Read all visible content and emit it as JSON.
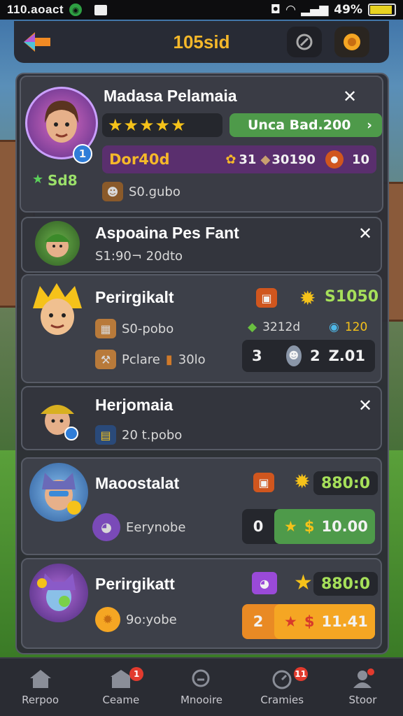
{
  "status_bar": {
    "time": "110.aoact",
    "battery": "49%"
  },
  "header": {
    "title": "105sid"
  },
  "players": [
    {
      "name": "Madasa Pelamaia",
      "level_text": "Sd8",
      "stars": "★★★★★",
      "action_label": "Unca Bad.200",
      "banner_label": "Dor40d",
      "banner_stat1": "31",
      "banner_stat2": "30190",
      "banner_stat3": "10",
      "sub_label": "S0.gubo"
    },
    {
      "name": "Aspoaina Pes Fant",
      "sub_label": "S1:90¬ 20dto"
    },
    {
      "name": "Perirgikalt",
      "coin_value": "S1050",
      "sub_label": "S0-pobo",
      "stat_a": "3212d",
      "stat_b": "120",
      "line2_label": "Pclare",
      "line2_value": "30lo",
      "score_left": "3",
      "score_mid": "2",
      "score_right": "Z.01"
    },
    {
      "name": "Herjomaia",
      "sub_label": "20 t.pobo"
    },
    {
      "name": "Maoostalat",
      "coin_value": "880:0",
      "sub_label": "Eerynobe",
      "score_left": "0",
      "score_right": "10.00"
    },
    {
      "name": "Perirgikatt",
      "coin_value": "880:0",
      "sub_label": "9o:yobe",
      "score_left": "2",
      "score_right": "11.41"
    }
  ],
  "nav": [
    {
      "label": "Rerpoo",
      "icon": "home-icon"
    },
    {
      "label": "Ceame",
      "icon": "shop-icon",
      "badge": "1"
    },
    {
      "label": "Mnooire",
      "icon": "search-icon"
    },
    {
      "label": "Cramies",
      "icon": "timer-icon",
      "badge": "11"
    },
    {
      "label": "Stoor",
      "icon": "profile-icon"
    }
  ],
  "colors": {
    "accent": "#f5b82a",
    "green": "#4e9a4a",
    "orange": "#e98a24",
    "purple": "#5a2f6e"
  }
}
